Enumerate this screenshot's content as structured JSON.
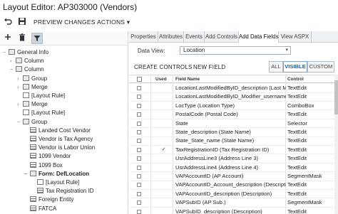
{
  "app": {
    "title": "Layout Editor: AP303000 (Vendors)"
  },
  "toolbar": {
    "undo_icon": "undo-icon",
    "save_icon": "save-icon",
    "preview_label": "PREVIEW CHANGES",
    "actions_label": "ACTIONS",
    "actions_chevron": "▾"
  },
  "left_toolbar": {
    "icons": [
      "add-icon",
      "delete-icon",
      "filter-icon"
    ]
  },
  "tree": [
    {
      "label": "General Info",
      "level": 0,
      "toggle": "−",
      "icon": "folder",
      "bold": false
    },
    {
      "label": "Column",
      "level": 1,
      "toggle": "›",
      "icon": "folder",
      "bold": false
    },
    {
      "label": "Column",
      "level": 1,
      "toggle": "−",
      "icon": "folder",
      "bold": false
    },
    {
      "label": "Group",
      "level": 2,
      "toggle": "›",
      "icon": "folder",
      "bold": false
    },
    {
      "label": "Merge",
      "level": 2,
      "toggle": "›",
      "icon": "folder",
      "bold": false
    },
    {
      "label": "[Layout Rule]",
      "level": 2,
      "toggle": "",
      "icon": "field",
      "bold": false
    },
    {
      "label": "Merge",
      "level": 2,
      "toggle": "›",
      "icon": "folder",
      "bold": false
    },
    {
      "label": "[Layout Rule]",
      "level": 2,
      "toggle": "",
      "icon": "field",
      "bold": false
    },
    {
      "label": "Group",
      "level": 2,
      "toggle": "−",
      "icon": "folder",
      "bold": false
    },
    {
      "label": "Landed Cost Vendor",
      "level": 3,
      "toggle": "",
      "icon": "grid",
      "bold": false
    },
    {
      "label": "Vendor is Tax Agency",
      "level": 3,
      "toggle": "",
      "icon": "grid",
      "bold": false
    },
    {
      "label": "Vendor is Labor Union",
      "level": 3,
      "toggle": "",
      "icon": "grid",
      "bold": false
    },
    {
      "label": "1099 Vendor",
      "level": 3,
      "toggle": "",
      "icon": "grid",
      "bold": false
    },
    {
      "label": "1099 Box",
      "level": 3,
      "toggle": "",
      "icon": "grid",
      "bold": false
    },
    {
      "label": "Form: DefLocation",
      "level": 3,
      "toggle": "−",
      "icon": "folder",
      "bold": true
    },
    {
      "label": "[Layout Rule]",
      "level": 4,
      "toggle": "",
      "icon": "field",
      "bold": false
    },
    {
      "label": "Tax Registration ID",
      "level": 4,
      "toggle": "",
      "icon": "grid",
      "bold": false
    },
    {
      "label": "Foreign Entity",
      "level": 3,
      "toggle": "",
      "icon": "grid",
      "bold": false
    },
    {
      "label": "FATCA",
      "level": 3,
      "toggle": "",
      "icon": "grid",
      "bold": false
    }
  ],
  "tabs": [
    {
      "label": "Properties",
      "active": false
    },
    {
      "label": "Attributes",
      "active": false
    },
    {
      "label": "Events",
      "active": false
    },
    {
      "label": "Add Controls",
      "active": false
    },
    {
      "label": "Add Data Fields",
      "active": true
    },
    {
      "label": "View ASPX",
      "active": false
    }
  ],
  "data_view": {
    "label": "Data View:",
    "value": "Location",
    "chevron": "▾"
  },
  "actions": {
    "create_controls": "CREATE CONTROLS",
    "new_field": "NEW FIELD",
    "filters": [
      {
        "label": "ALL",
        "active": false
      },
      {
        "label": "VISIBLE",
        "active": true
      },
      {
        "label": "CUSTOM",
        "active": false
      }
    ]
  },
  "grid": {
    "headers": {
      "used": "Used",
      "field_name": "Field Name",
      "control": "Control"
    },
    "rows": [
      {
        "field_name": "LocationLastModifiedByID_description (Last Modi",
        "control": "TextEdit",
        "used": false
      },
      {
        "field_name": "LocationLastModifiedByID_Modifier_username (L",
        "control": "TextEdit",
        "used": false
      },
      {
        "field_name": "LocType (Location Type)",
        "control": "ComboBox",
        "used": false
      },
      {
        "field_name": "PostalCode (Postal Code)",
        "control": "TextEdit",
        "used": false
      },
      {
        "field_name": "State",
        "control": "Selector",
        "used": false
      },
      {
        "field_name": "State_description (State Name)",
        "control": "TextEdit",
        "used": false
      },
      {
        "field_name": "State_State_name (State Name)",
        "control": "TextEdit",
        "used": false
      },
      {
        "field_name": "TaxRegistrationID (Tax Registration ID)",
        "control": "TextEdit",
        "used": true
      },
      {
        "field_name": "UsrAddressLine3 (Address Line 3)",
        "control": "TextEdit",
        "used": false
      },
      {
        "field_name": "UsrAddressLine4 (Address Line 4)",
        "control": "TextEdit",
        "used": false
      },
      {
        "field_name": "VAPAccountID (AP Account)",
        "control": "SegmentMask",
        "used": false
      },
      {
        "field_name": "VAPAccountID_Account_description (Description",
        "control": "TextEdit",
        "used": false
      },
      {
        "field_name": "VAPAccountID_description (Description)",
        "control": "TextEdit",
        "used": false
      },
      {
        "field_name": "VAPSubID (AP Sub.)",
        "control": "SegmentMask",
        "used": false
      },
      {
        "field_name": "VAPSubID_description (Description)",
        "control": "TextEdit",
        "used": false
      }
    ]
  }
}
